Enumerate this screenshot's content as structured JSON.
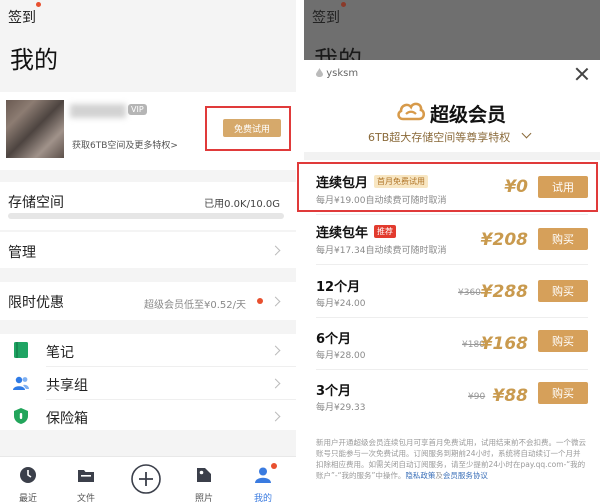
{
  "left": {
    "checkin": "签到",
    "title": "我的",
    "profile": {
      "vip_badge": "VIP",
      "subtitle": "获取6TB空间及更多特权>",
      "trial_button": "免费试用"
    },
    "storage": {
      "label": "存储空间",
      "value": "已用0.0K/10.0G",
      "used_fraction": 0
    },
    "manage": {
      "label": "管理"
    },
    "promo": {
      "label": "限时优惠",
      "subtitle": "超级会员低至¥0.52/天"
    },
    "features": [
      {
        "label": "笔记",
        "icon": "notebook-icon"
      },
      {
        "label": "共享组",
        "icon": "people-icon"
      },
      {
        "label": "保险箱",
        "icon": "shield-icon"
      }
    ],
    "tabbar": [
      {
        "label": "最近",
        "icon": "clock-icon"
      },
      {
        "label": "文件",
        "icon": "folder-icon"
      },
      {
        "label": "",
        "icon": "plus-icon"
      },
      {
        "label": "照片",
        "icon": "photo-icon"
      },
      {
        "label": "我的",
        "icon": "user-icon"
      }
    ]
  },
  "right": {
    "checkin": "签到",
    "title": "我的",
    "username": "ysksm",
    "vip_title": "超级会员",
    "vip_subtitle": "6TB超大存储空间等尊享特权",
    "plans": [
      {
        "title": "连续包月",
        "tag": "首月免费试用",
        "desc": "每月¥19.00自动续费可随时取消",
        "old_price": "",
        "price": "¥0",
        "button": "试用"
      },
      {
        "title": "连续包年",
        "tag": "推荐",
        "desc": "每月¥17.34自动续费可随时取消",
        "old_price": "",
        "price": "¥208",
        "button": "购买"
      },
      {
        "title": "12个月",
        "tag": "",
        "desc": "每月¥24.00",
        "old_price": "¥360",
        "price": "¥288",
        "button": "购买"
      },
      {
        "title": "6个月",
        "tag": "",
        "desc": "每月¥28.00",
        "old_price": "¥180",
        "price": "¥168",
        "button": "购买"
      },
      {
        "title": "3个月",
        "tag": "",
        "desc": "每月¥29.33",
        "old_price": "¥90",
        "price": "¥88",
        "button": "购买"
      }
    ],
    "footnote": {
      "text": "新用户开通超级会员连续包月可享首月免费试用，试用结束前不会扣费。一个微云账号只能参与一次免费试用。订阅服务到期前24小时，系统将自动续订一个月并扣除相应费用。如需关闭自动订阅服务，请至少提前24小时在pay.qq.com-“我的账户”-“我的服务”中操作。",
      "link_privacy": "隐私政策",
      "connector": "及",
      "link_terms": "会员服务协议"
    }
  },
  "colors": {
    "gold": "#d6a05a",
    "price": "#c99a4e",
    "highlight_red": "#e03a3a",
    "accent_blue": "#3a7be0",
    "notebook_green": "#1fa463",
    "people_blue": "#2f7be6",
    "shield_green": "#22a55b"
  }
}
